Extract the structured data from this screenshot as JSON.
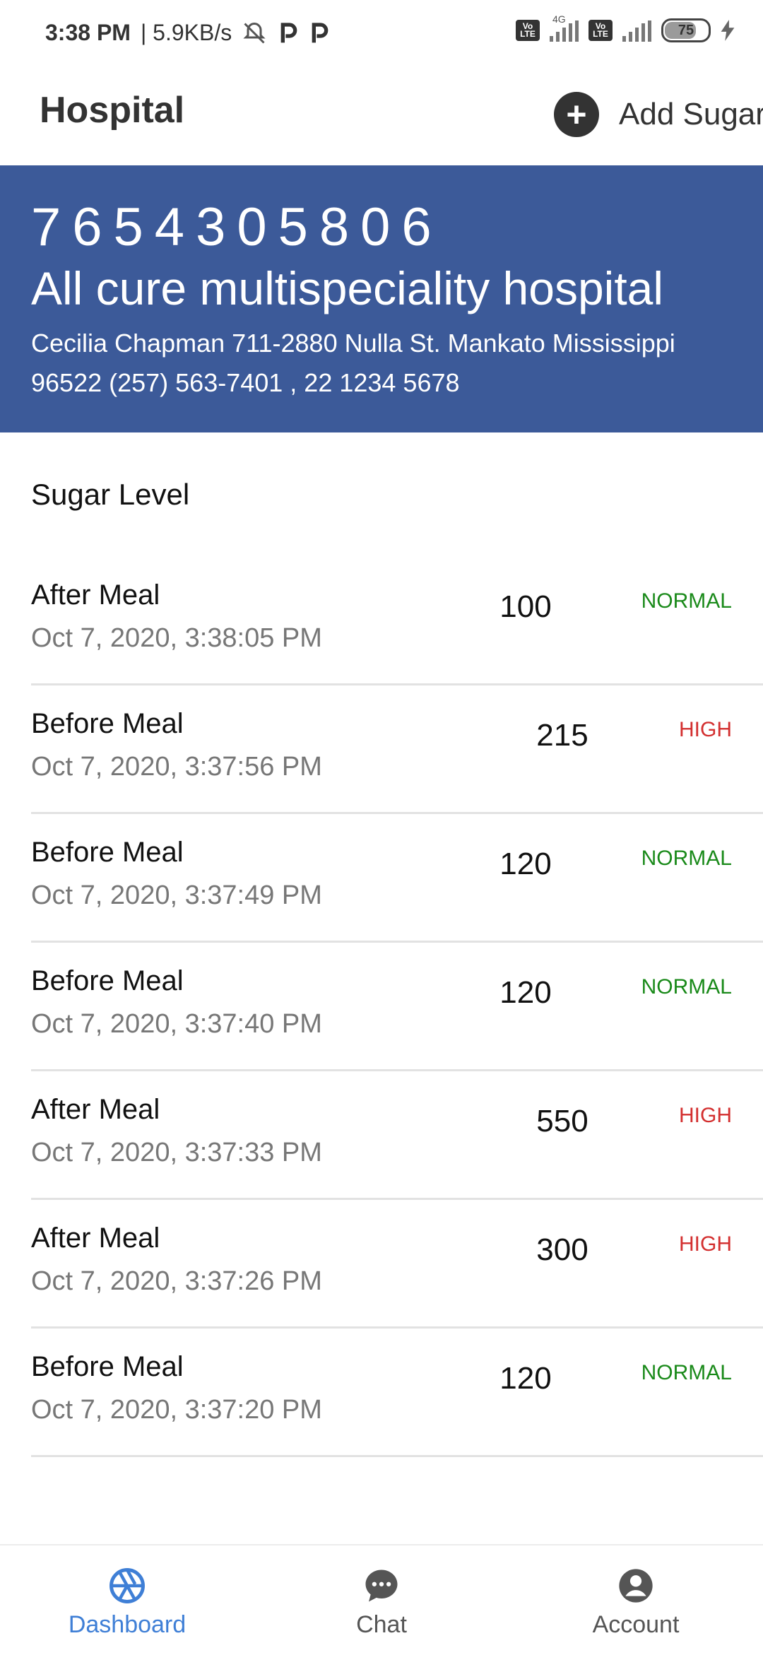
{
  "status_bar": {
    "time": "3:38 PM",
    "speed": "| 5.9KB/s",
    "network": "4G",
    "volte": "Vo LTE",
    "battery": "75"
  },
  "app_bar": {
    "title": "Hospital",
    "add_label": "Add Sugar"
  },
  "hospital": {
    "phone": "7654305806",
    "name": "All cure multispeciality hospital",
    "address": "Cecilia Chapman 711-2880 Nulla St. Mankato Mississippi 96522 (257) 563-7401 , 22 1234 5678"
  },
  "section": {
    "title": "Sugar Level"
  },
  "readings": [
    {
      "meal": "After Meal",
      "time": "Oct 7, 2020, 3:38:05 PM",
      "value": "100",
      "status": "NORMAL"
    },
    {
      "meal": "Before Meal",
      "time": "Oct 7, 2020, 3:37:56 PM",
      "value": "215",
      "status": "HIGH"
    },
    {
      "meal": "Before Meal",
      "time": "Oct 7, 2020, 3:37:49 PM",
      "value": "120",
      "status": "NORMAL"
    },
    {
      "meal": "Before Meal",
      "time": "Oct 7, 2020, 3:37:40 PM",
      "value": "120",
      "status": "NORMAL"
    },
    {
      "meal": "After Meal",
      "time": "Oct 7, 2020, 3:37:33 PM",
      "value": "550",
      "status": "HIGH"
    },
    {
      "meal": "After Meal",
      "time": "Oct 7, 2020, 3:37:26 PM",
      "value": "300",
      "status": "HIGH"
    },
    {
      "meal": "Before Meal",
      "time": "Oct 7, 2020, 3:37:20 PM",
      "value": "120",
      "status": "NORMAL"
    }
  ],
  "status_colors": {
    "NORMAL": "#1a8a1a",
    "HIGH": "#d32f2f"
  },
  "bottom_nav": {
    "active_color": "#3f7fd6",
    "inactive_color": "#555555",
    "items": [
      {
        "label": "Dashboard",
        "icon": "aperture-icon",
        "active": true
      },
      {
        "label": "Chat",
        "icon": "chat-bubble-icon",
        "active": false
      },
      {
        "label": "Account",
        "icon": "account-circle-icon",
        "active": false
      }
    ]
  }
}
